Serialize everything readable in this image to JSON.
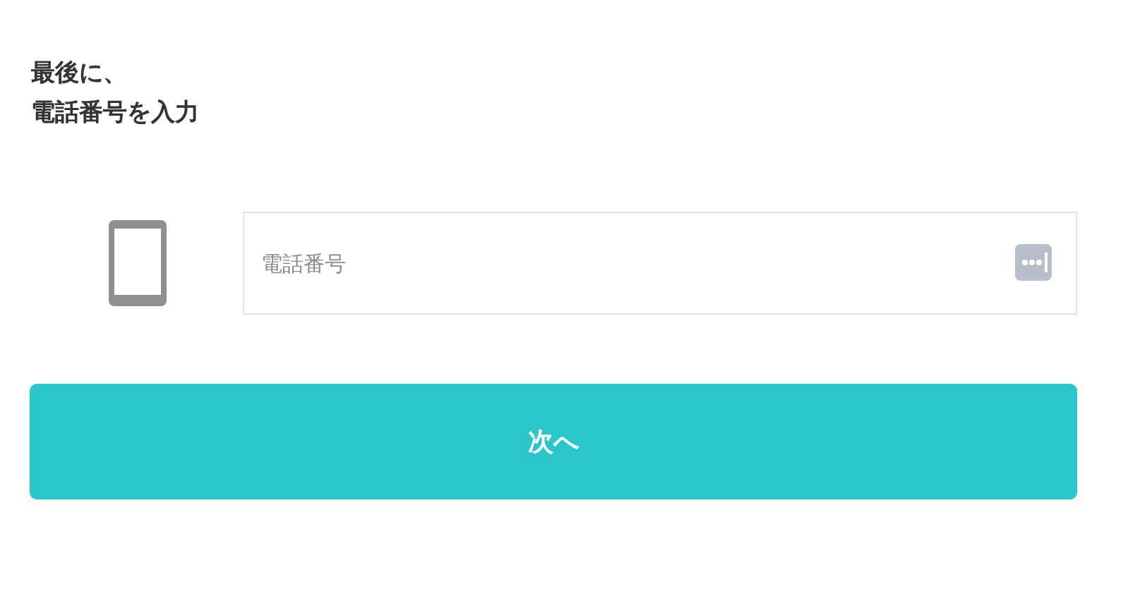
{
  "heading": {
    "lines": [
      "最後に、",
      "電話番号を入力"
    ]
  },
  "phone_field": {
    "placeholder": "電話番号"
  },
  "next_button": {
    "label": "次へ"
  }
}
